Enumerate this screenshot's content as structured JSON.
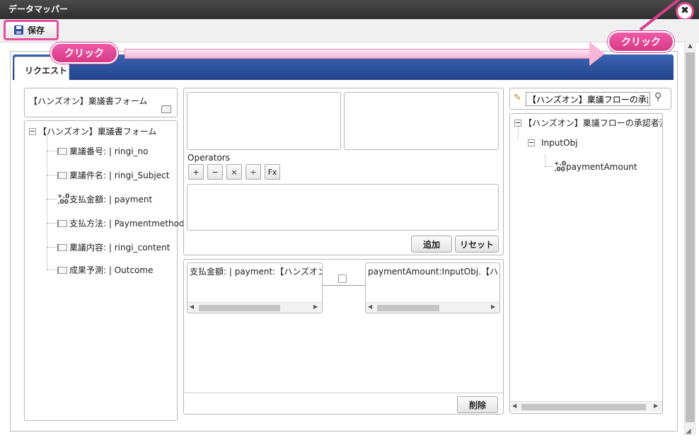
{
  "window": {
    "title": "データマッパー",
    "close_glyph": "✖"
  },
  "toolbar": {
    "save_label": "保存"
  },
  "tabs": [
    {
      "label": "リクエスト"
    }
  ],
  "callouts": {
    "left": "クリック",
    "right": "クリック"
  },
  "left_panel": {
    "form_title": "【ハンズオン】稟議書フォーム",
    "tree_root": "【ハンズオン】稟議書フォーム",
    "fields": [
      {
        "label": "稟議番号: | ringi_no",
        "icon": "field-icon"
      },
      {
        "label": "稟議件名: | ringi_Subject",
        "icon": "field-icon"
      },
      {
        "label": "支払金額: | payment",
        "icon": "number-icon"
      },
      {
        "label": "支払方法: | Paymentmethod",
        "icon": "field-icon"
      },
      {
        "label": "稟議内容: | ringi_content",
        "icon": "field-icon"
      },
      {
        "label": "成果予測: | Outcome",
        "icon": "field-icon"
      }
    ]
  },
  "middle_panel": {
    "operators_label": "Operators",
    "operators": [
      "+",
      "−",
      "×",
      "÷",
      "Fx"
    ],
    "add_label": "追加",
    "reset_label": "リセット",
    "mapping_source": "支払金額: | payment:【ハンズオン】稟",
    "mapping_target": "paymentAmount:InputObj.【ハンズフ",
    "delete_label": "削除"
  },
  "right_panel": {
    "search_value": "【ハンズオン】稟議フローの承認者",
    "tree_root": "【ハンズオン】稟議フローの承認者決定",
    "obj": "InputObj",
    "leaf": "paymentAmount"
  },
  "number_icon_glyph": "+.0\n.00"
}
